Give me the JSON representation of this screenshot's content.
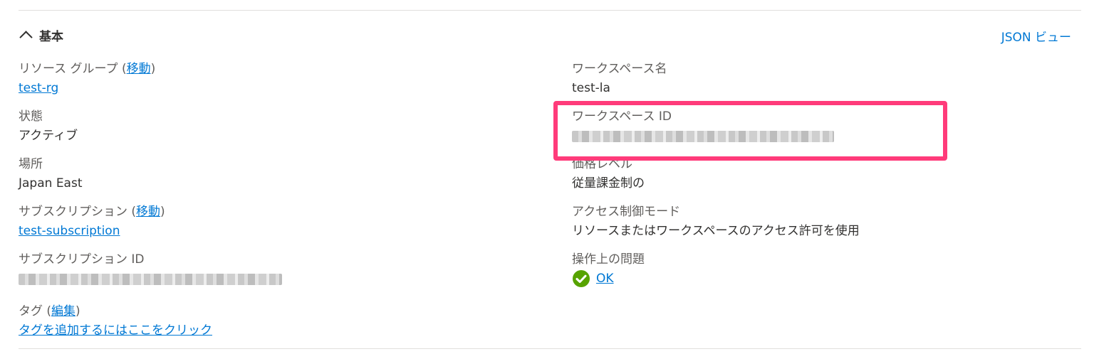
{
  "section": {
    "title": "基本",
    "json_view_label": "JSON ビュー"
  },
  "left": {
    "resource_group": {
      "label": "リソース グループ",
      "move_link": "移動",
      "value": "test-rg"
    },
    "status": {
      "label": "状態",
      "value": "アクティブ"
    },
    "location": {
      "label": "場所",
      "value": "Japan East"
    },
    "subscription": {
      "label": "サブスクリプション",
      "move_link": "移動",
      "value": "test-subscription"
    },
    "subscription_id": {
      "label": "サブスクリプション ID"
    },
    "tags": {
      "label": "タグ",
      "edit_link": "編集",
      "value": "タグを追加するにはここをクリック"
    }
  },
  "right": {
    "workspace_name": {
      "label": "ワークスペース名",
      "value": "test-la"
    },
    "workspace_id": {
      "label": "ワークスペース ID"
    },
    "pricing_tier": {
      "label": "価格レベル",
      "value": "従量課金制の"
    },
    "access_control_mode": {
      "label": "アクセス制御モード",
      "value": "リソースまたはワークスペースのアクセス許可を使用"
    },
    "operational_issues": {
      "label": "操作上の問題",
      "value": "OK"
    }
  },
  "colors": {
    "link": "#0078d4",
    "highlight": "#ff3b7a",
    "ok_green": "#57a300",
    "text": "#323130",
    "label": "#605e5c"
  },
  "icons": {
    "collapse": "chevron-up-icon",
    "ok": "checkmark-circle-icon"
  }
}
